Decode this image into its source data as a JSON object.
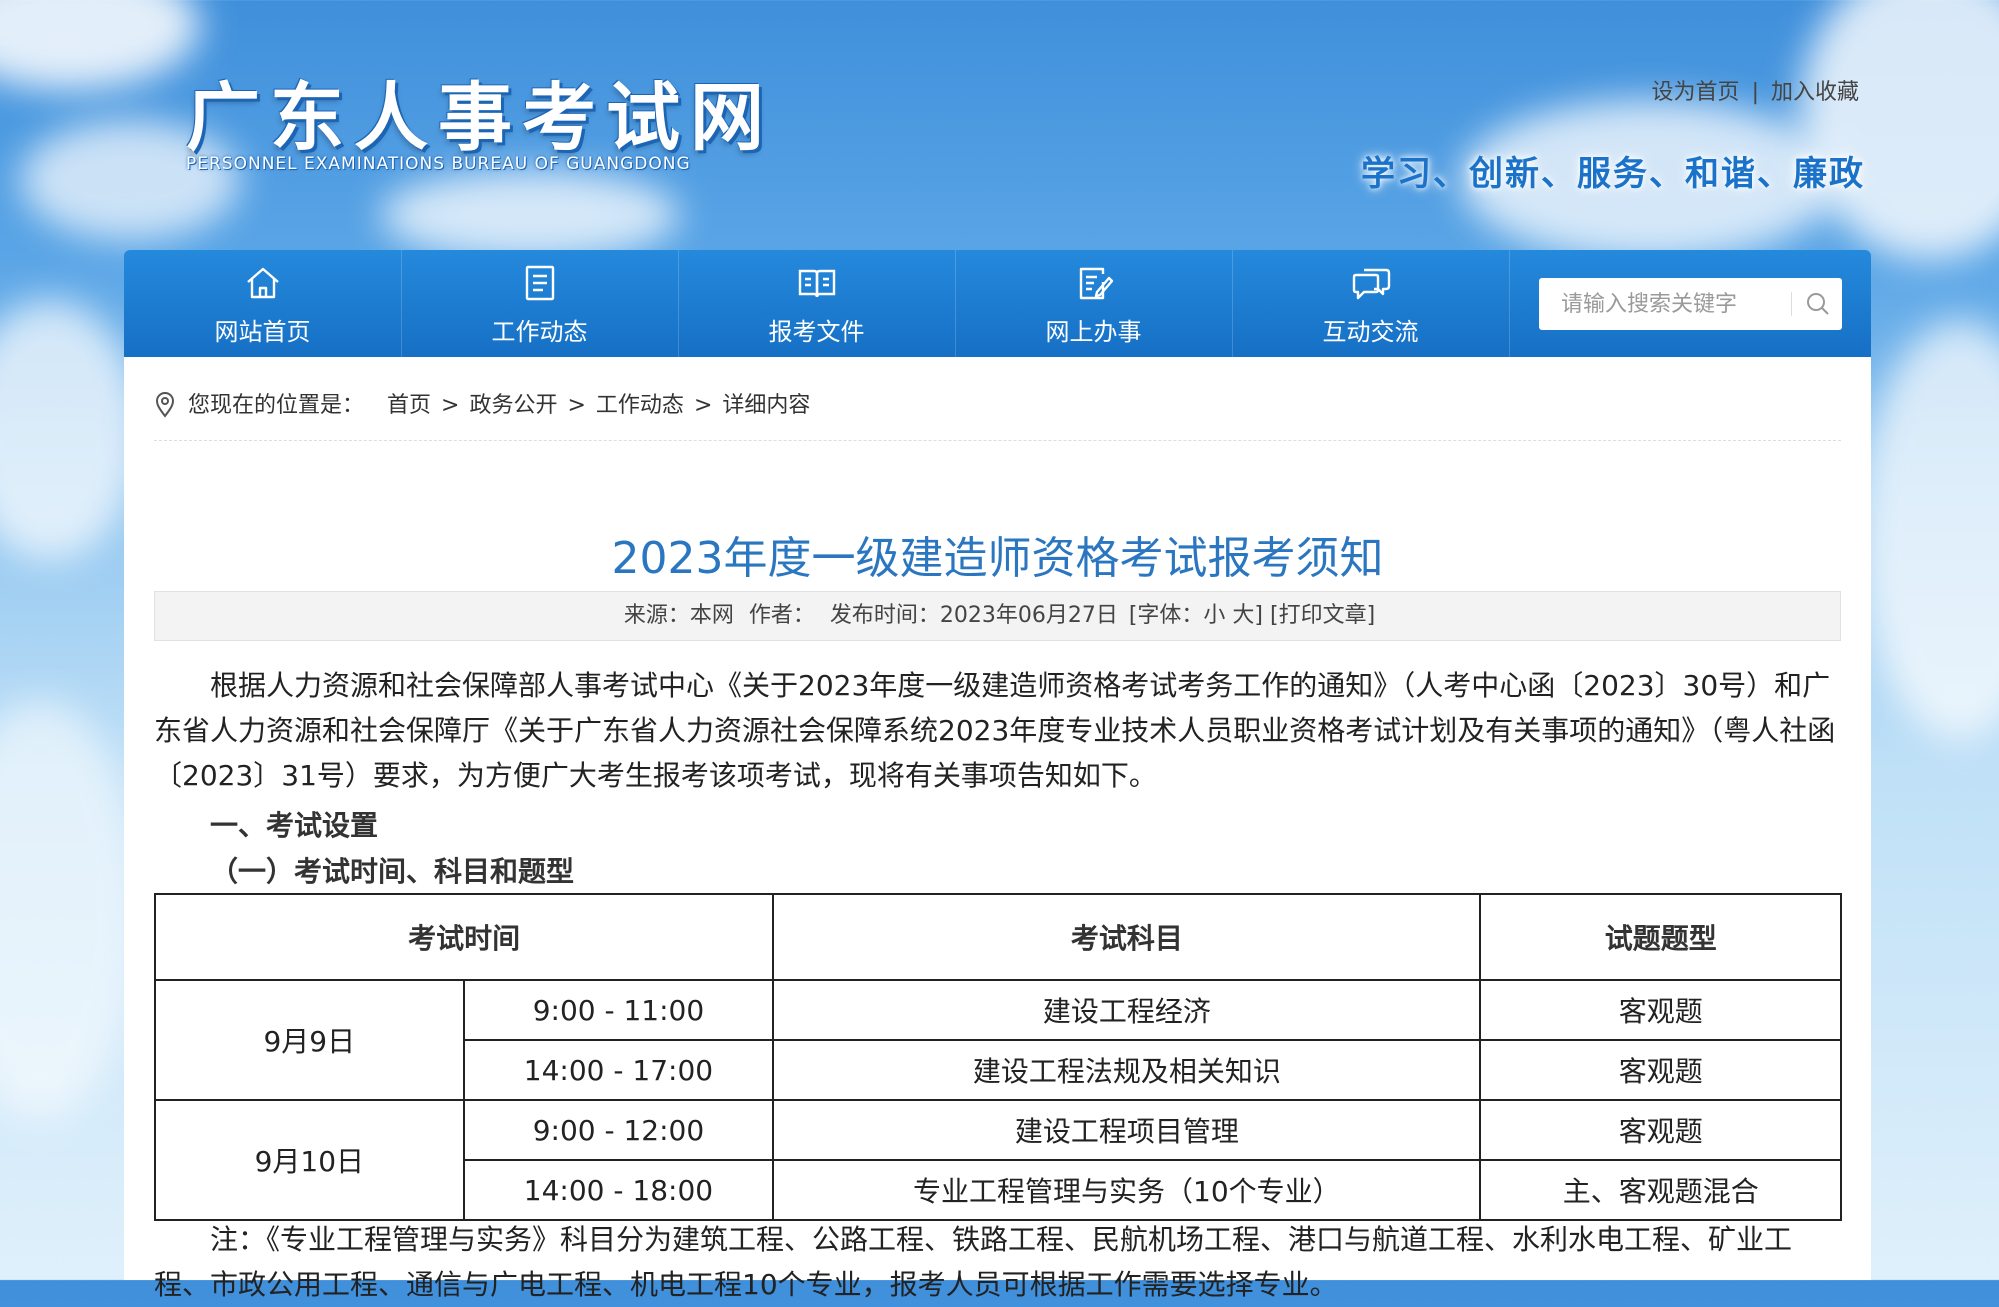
{
  "header": {
    "logo_cn": "广东人事考试网",
    "logo_en": "PERSONNEL EXAMINATIONS BUREAU OF GUANGDONG",
    "set_homepage": "设为首页",
    "separator": "|",
    "add_favorite": "加入收藏",
    "slogan": "学习、创新、服务、和谐、廉政"
  },
  "nav": {
    "items": [
      {
        "label": "网站首页",
        "icon": "home-icon"
      },
      {
        "label": "工作动态",
        "icon": "document-list-icon"
      },
      {
        "label": "报考文件",
        "icon": "open-book-icon"
      },
      {
        "label": "网上办事",
        "icon": "edit-document-icon"
      },
      {
        "label": "互动交流",
        "icon": "chat-bubbles-icon"
      }
    ],
    "search_placeholder": "请输入搜索关键字"
  },
  "breadcrumb": {
    "prefix": "您现在的位置是：",
    "items": [
      "首页",
      "政务公开",
      "工作动态",
      "详细内容"
    ],
    "sep": ">"
  },
  "article": {
    "title": "2023年度一级建造师资格考试报考须知",
    "meta": {
      "source": "来源：本网",
      "author": "作者：",
      "published": "发布时间：2023年06月27日",
      "font_size": "[字体：小 大]",
      "print": "[打印文章]"
    },
    "intro": "根据人力资源和社会保障部人事考试中心《关于2023年度一级建造师资格考试考务工作的通知》（人考中心函〔2023〕30号）和广东省人力资源和社会保障厅《关于广东省人力资源社会保障系统2023年度专业技术人员职业资格考试计划及有关事项的通知》（粤人社函〔2023〕31号）要求，为方便广大考生报考该项考试，现将有关事项告知如下。",
    "section1": "一、考试设置",
    "section1_1": "（一）考试时间、科目和题型",
    "table": {
      "headers": [
        "考试时间",
        "考试科目",
        "试题题型"
      ],
      "days": [
        {
          "date": "9月9日",
          "rows": [
            {
              "time": "9:00 - 11:00",
              "subject": "建设工程经济",
              "type": "客观题"
            },
            {
              "time": "14:00 - 17:00",
              "subject": "建设工程法规及相关知识",
              "type": "客观题"
            }
          ]
        },
        {
          "date": "9月10日",
          "rows": [
            {
              "time": "9:00 - 12:00",
              "subject": "建设工程项目管理",
              "type": "客观题"
            },
            {
              "time": "14:00 - 18:00",
              "subject": "专业工程管理与实务（10个专业）",
              "type": "主、客观题混合"
            }
          ]
        }
      ]
    },
    "note": "注：《专业工程管理与实务》科目分为建筑工程、公路工程、铁路工程、民航机场工程、港口与航道工程、水利水电工程、矿业工程、市政公用工程、通信与广电工程、机电工程10个专业，报考人员可根据工作需要选择专业。"
  },
  "colors": {
    "nav_bg": "#1670c5",
    "title_blue": "#2a76c0",
    "slogan_blue": "#1a72c9"
  }
}
